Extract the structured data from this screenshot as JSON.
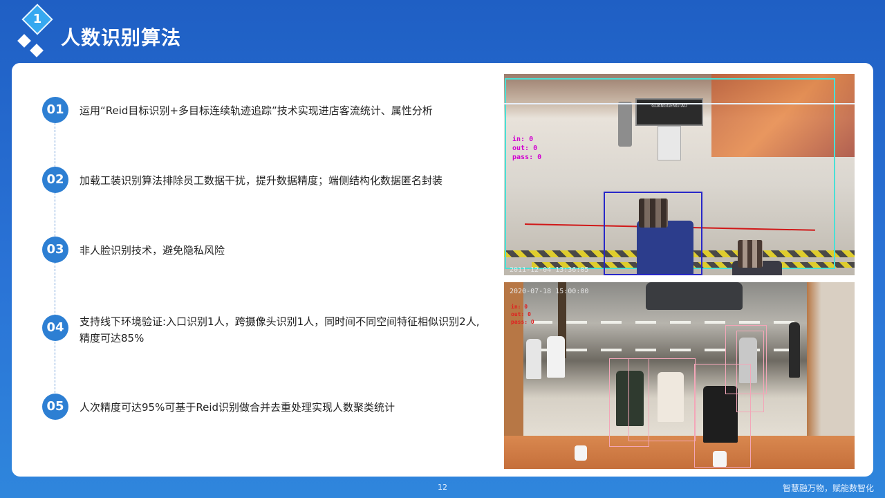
{
  "header": {
    "section_number": "1",
    "title": "人数识别算法"
  },
  "items": [
    {
      "number": "01",
      "text": "运用“Reid目标识别+多目标连续轨迹追踪”技术实现进店客流统计、属性分析"
    },
    {
      "number": "02",
      "text": "加载工装识别算法排除员工数据干扰，提升数据精度；端侧结构化数据匿名封装"
    },
    {
      "number": "03",
      "text": "非人脸识别技术，避免隐私风险"
    },
    {
      "number": "04",
      "text": "支持线下环境验证:入口识别1人，跨摄像头识别1人，同时间不同空间特征相似识别2人,精度可达85%"
    },
    {
      "number": "05",
      "text": "人次精度可达95%可基于Reid识别做合并去重处理实现人数聚类统计"
    }
  ],
  "camera1": {
    "timestamp": "2011-12-04 13:36:05",
    "overlay": [
      "in: 0",
      "out: 0",
      "pass: 0"
    ],
    "sign_text": "GUANGGENGTAO"
  },
  "camera2": {
    "timestamp": "2020-07-18 15:00:00",
    "overlay": [
      "in: 0",
      "out: 0",
      "pass: 0"
    ]
  },
  "footer": {
    "page_number": "12",
    "slogan": "智慧融万物，赋能数智化"
  },
  "colors": {
    "background": "#2a73d6",
    "badge": "#2d7fd3",
    "accent_light": "#36a8f0"
  }
}
